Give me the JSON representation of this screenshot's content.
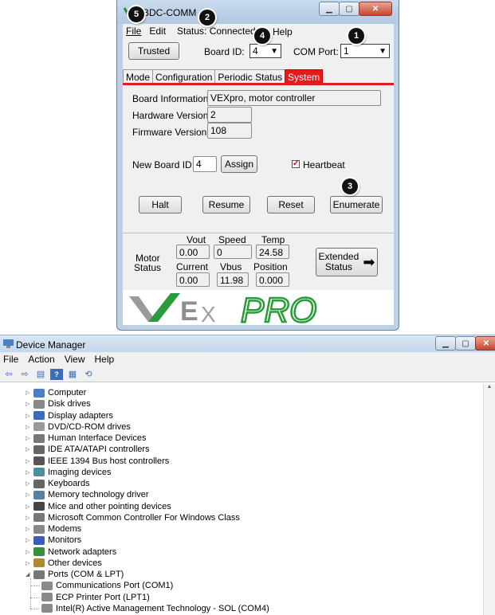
{
  "comm_window": {
    "title": "BDC-COMM",
    "menu": {
      "file": "File",
      "edit": "Edit",
      "help": "Help",
      "status": "Status: Connected"
    },
    "trusted_label": "Trusted",
    "board_id_label": "Board ID:",
    "board_id_value": "4",
    "com_port_label": "COM Port:",
    "com_port_value": "1",
    "tabs": [
      {
        "label": "Mode",
        "active": false
      },
      {
        "label": "Configuration",
        "active": false
      },
      {
        "label": "Periodic Status",
        "active": false
      },
      {
        "label": "System",
        "active": true
      }
    ],
    "board_info_label": "Board Information:",
    "board_info_value": "VEXpro, motor controller",
    "hardware_version_label": "Hardware Version:",
    "hardware_version_value": "2",
    "firmware_version_label": "Firmware Version:",
    "firmware_version_value": "108",
    "new_board_id_label": "New Board ID:",
    "new_board_id_value": "4",
    "assign_label": "Assign",
    "heartbeat_label": "Heartbeat",
    "heartbeat_checked": true,
    "buttons": {
      "halt": "Halt",
      "resume": "Resume",
      "reset": "Reset",
      "enumerate": "Enumerate"
    },
    "motor_status": {
      "label_line1": "Motor",
      "label_line2": "Status",
      "vout_label": "Vout",
      "vout_value": "0.00",
      "speed_label": "Speed",
      "speed_value": "0",
      "temp_label": "Temp",
      "temp_value": "24.58",
      "current_label": "Current",
      "current_value": "0.00",
      "vbus_label": "Vbus",
      "vbus_value": "11.98",
      "position_label": "Position",
      "position_value": "0.000"
    },
    "extended_status_line1": "Extended",
    "extended_status_line2": "Status",
    "logo_text": "VEX PRO",
    "accent_color": "#e8191b"
  },
  "callouts": [
    "1",
    "2",
    "3",
    "4",
    "5"
  ],
  "device_manager": {
    "title": "Device Manager",
    "menu": [
      "File",
      "Action",
      "View",
      "Help"
    ],
    "tree": [
      {
        "label": "Computer",
        "icon": "computer-icon"
      },
      {
        "label": "Disk drives",
        "icon": "disk-icon"
      },
      {
        "label": "Display adapters",
        "icon": "display-icon"
      },
      {
        "label": "DVD/CD-ROM drives",
        "icon": "dvd-icon"
      },
      {
        "label": "Human Interface Devices",
        "icon": "hid-icon"
      },
      {
        "label": "IDE ATA/ATAPI controllers",
        "icon": "ide-icon"
      },
      {
        "label": "IEEE 1394 Bus host controllers",
        "icon": "ieee-icon"
      },
      {
        "label": "Imaging devices",
        "icon": "imaging-icon"
      },
      {
        "label": "Keyboards",
        "icon": "keyboard-icon"
      },
      {
        "label": "Memory technology driver",
        "icon": "memory-icon"
      },
      {
        "label": "Mice and other pointing devices",
        "icon": "mouse-icon"
      },
      {
        "label": "Microsoft Common Controller For Windows Class",
        "icon": "controller-icon"
      },
      {
        "label": "Modems",
        "icon": "modem-icon"
      },
      {
        "label": "Monitors",
        "icon": "monitor-icon"
      },
      {
        "label": "Network adapters",
        "icon": "network-icon"
      },
      {
        "label": "Other devices",
        "icon": "other-device-icon"
      },
      {
        "label": "Ports (COM & LPT)",
        "icon": "port-icon"
      }
    ],
    "port_children": [
      "Communications Port (COM1)",
      "ECP Printer Port (LPT1)",
      "Intel(R) Active Management Technology - SOL (COM4)"
    ]
  }
}
